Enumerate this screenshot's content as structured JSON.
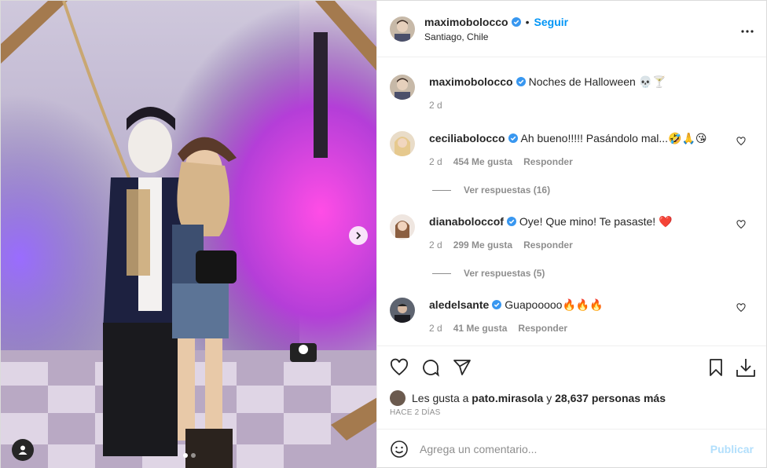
{
  "post": {
    "username": "maximobolocco",
    "follow_label": "Seguir",
    "bullet": "•",
    "location": "Santiago, Chile",
    "caption": "Noches de Halloween 💀🍸",
    "caption_age": "2 d",
    "carousel_count": 2,
    "carousel_active": 1
  },
  "comments": [
    {
      "username": "ceciliabolocco",
      "text": "Ah bueno!!!!! Pasándolo mal...🤣🙏😘",
      "age": "2 d",
      "likes": "454 Me gusta",
      "reply": "Responder",
      "view_replies": "Ver respuestas (16)"
    },
    {
      "username": "dianaboloccof",
      "text": "Oye! Que mino! Te pasaste! ❤️",
      "age": "2 d",
      "likes": "299 Me gusta",
      "reply": "Responder",
      "view_replies": "Ver respuestas (5)"
    },
    {
      "username": "aledelsante",
      "text": "Guapooooo🔥🔥🔥",
      "age": "2 d",
      "likes": "41 Me gusta",
      "reply": "Responder"
    }
  ],
  "likes": {
    "prefix": "Les gusta a",
    "user": "pato.mirasola",
    "conj": "y",
    "count": "28,637 personas más"
  },
  "timestamp": "HACE 2 DÍAS",
  "composer": {
    "placeholder": "Agrega un comentario...",
    "publish": "Publicar"
  },
  "icons": {
    "verified": "verified-badge-icon",
    "more": "more-options-icon",
    "heart": "heart-icon",
    "comment": "comment-icon",
    "share": "share-icon",
    "save": "bookmark-icon",
    "download": "download-icon",
    "emoji": "emoji-icon",
    "next": "chevron-right-icon",
    "user_tag": "user-tag-icon"
  },
  "colors": {
    "accent": "#0095f6",
    "publish_disabled": "#b2dffc",
    "verified": "#3897f0",
    "muted": "#8e8e8e"
  }
}
